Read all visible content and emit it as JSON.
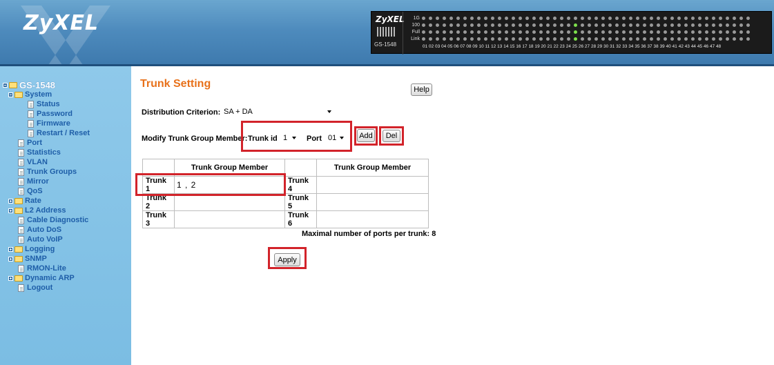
{
  "header": {
    "logo": "ZyXEL",
    "device_brand": "ZyXEL",
    "device_model": "GS-1548",
    "led_rows": [
      "1G",
      "100",
      "Full",
      "Link"
    ],
    "port_numbers": "01 02 03 04 05 06 07 08 09 10 11 12 13 14 15 16 17 18 19 20 21 22 23 24 25 26 27 28 29 30 31 32 33 34 35 36 37 38 39 40 41 42 43 44 45 46 47 48"
  },
  "sidebar": {
    "root": "GS-1548",
    "items": [
      {
        "label": "System"
      },
      {
        "label": "Status"
      },
      {
        "label": "Password"
      },
      {
        "label": "Firmware"
      },
      {
        "label": "Restart / Reset"
      },
      {
        "label": "Port"
      },
      {
        "label": "Statistics"
      },
      {
        "label": "VLAN"
      },
      {
        "label": "Trunk Groups"
      },
      {
        "label": "Mirror"
      },
      {
        "label": "QoS"
      },
      {
        "label": "Rate"
      },
      {
        "label": "L2 Address"
      },
      {
        "label": "Cable Diagnostic"
      },
      {
        "label": "Auto DoS"
      },
      {
        "label": "Auto VoIP"
      },
      {
        "label": "Logging"
      },
      {
        "label": "SNMP"
      },
      {
        "label": "RMON-Lite"
      },
      {
        "label": "Dynamic ARP"
      },
      {
        "label": "Logout"
      }
    ]
  },
  "main": {
    "title": "Trunk Setting",
    "help_label": "Help",
    "distribution_label": "Distribution Criterion:",
    "distribution_value": "SA + DA",
    "modify_label": "Modify Trunk Group Member:",
    "trunk_id_label": "Trunk id",
    "trunk_id_value": "1",
    "port_label": "Port",
    "port_value": "01",
    "add_label": "Add",
    "del_label": "Del",
    "table": {
      "header": "Trunk Group Member",
      "rows": [
        {
          "left_label": "Trunk 1",
          "left_value": "1 , 2",
          "right_label": "Trunk 4",
          "right_value": ""
        },
        {
          "left_label": "Trunk 2",
          "left_value": "",
          "right_label": "Trunk 5",
          "right_value": ""
        },
        {
          "left_label": "Trunk 3",
          "left_value": "",
          "right_label": "Trunk 6",
          "right_value": ""
        }
      ]
    },
    "max_note": "Maximal number of ports per trunk: 8",
    "apply_label": "Apply"
  }
}
